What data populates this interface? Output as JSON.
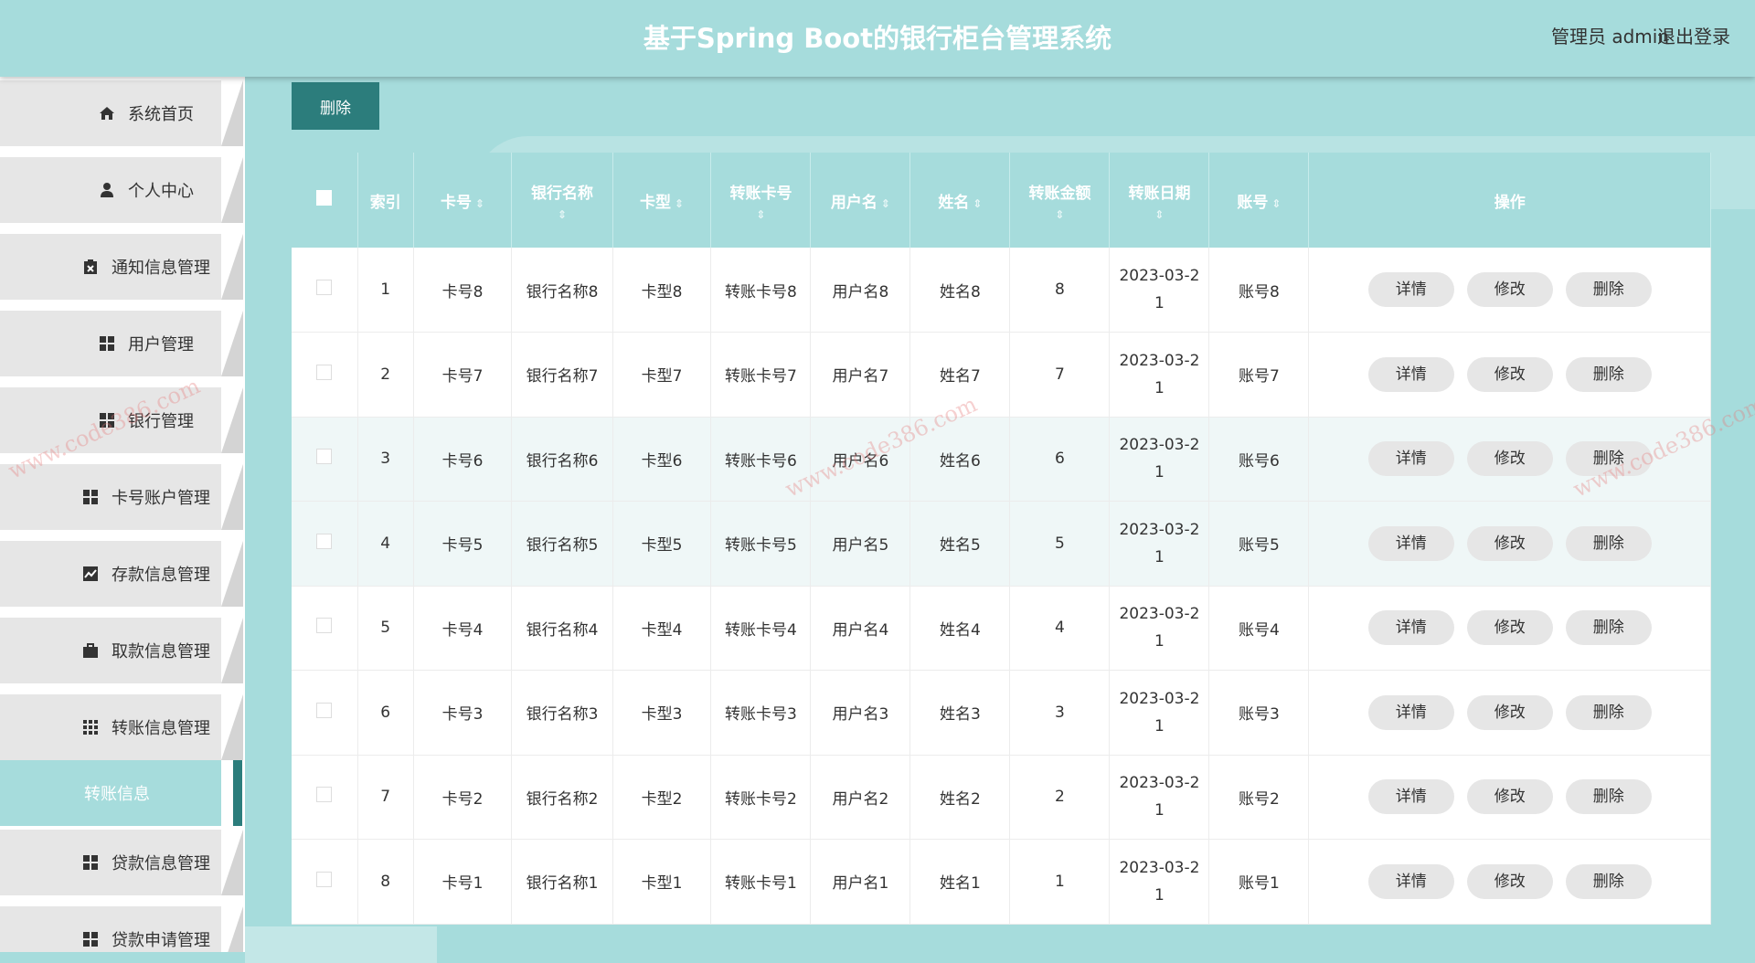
{
  "header": {
    "title": "基于Spring Boot的银行柜台管理系统",
    "user": "管理员 admin",
    "logout": "退出登录"
  },
  "sidebar": {
    "items": [
      {
        "label": "系统首页",
        "icon": "home-icon"
      },
      {
        "label": "个人中心",
        "icon": "user-icon"
      },
      {
        "label": "通知信息管理",
        "icon": "clipboard-icon"
      },
      {
        "label": "用户管理",
        "icon": "grid-icon"
      },
      {
        "label": "银行管理",
        "icon": "grid-icon"
      },
      {
        "label": "卡号账户管理",
        "icon": "grid-icon"
      },
      {
        "label": "存款信息管理",
        "icon": "chart-icon"
      },
      {
        "label": "取款信息管理",
        "icon": "briefcase-icon"
      },
      {
        "label": "转账信息管理",
        "icon": "table-icon"
      },
      {
        "label": "转账信息",
        "icon": "",
        "active": true
      },
      {
        "label": "贷款信息管理",
        "icon": "grid-icon"
      },
      {
        "label": "贷款申请管理",
        "icon": "grid-icon"
      }
    ]
  },
  "toolbar": {
    "delete_label": "删除"
  },
  "table": {
    "columns": [
      "索引",
      "卡号",
      "银行名称",
      "卡型",
      "转账卡号",
      "用户名",
      "姓名",
      "转账金额",
      "转账日期",
      "账号",
      "操作"
    ],
    "rows": [
      {
        "index": "1",
        "card": "卡号8",
        "bank": "银行名称8",
        "type": "卡型8",
        "tcard": "转账卡号8",
        "uname": "用户名8",
        "name": "姓名8",
        "amount": "8",
        "date1": "2023-03-2",
        "date2": "1",
        "account": "账号8"
      },
      {
        "index": "2",
        "card": "卡号7",
        "bank": "银行名称7",
        "type": "卡型7",
        "tcard": "转账卡号7",
        "uname": "用户名7",
        "name": "姓名7",
        "amount": "7",
        "date1": "2023-03-2",
        "date2": "1",
        "account": "账号7"
      },
      {
        "index": "3",
        "card": "卡号6",
        "bank": "银行名称6",
        "type": "卡型6",
        "tcard": "转账卡号6",
        "uname": "用户名6",
        "name": "姓名6",
        "amount": "6",
        "date1": "2023-03-2",
        "date2": "1",
        "account": "账号6"
      },
      {
        "index": "4",
        "card": "卡号5",
        "bank": "银行名称5",
        "type": "卡型5",
        "tcard": "转账卡号5",
        "uname": "用户名5",
        "name": "姓名5",
        "amount": "5",
        "date1": "2023-03-2",
        "date2": "1",
        "account": "账号5"
      },
      {
        "index": "5",
        "card": "卡号4",
        "bank": "银行名称4",
        "type": "卡型4",
        "tcard": "转账卡号4",
        "uname": "用户名4",
        "name": "姓名4",
        "amount": "4",
        "date1": "2023-03-2",
        "date2": "1",
        "account": "账号4"
      },
      {
        "index": "6",
        "card": "卡号3",
        "bank": "银行名称3",
        "type": "卡型3",
        "tcard": "转账卡号3",
        "uname": "用户名3",
        "name": "姓名3",
        "amount": "3",
        "date1": "2023-03-2",
        "date2": "1",
        "account": "账号3"
      },
      {
        "index": "7",
        "card": "卡号2",
        "bank": "银行名称2",
        "type": "卡型2",
        "tcard": "转账卡号2",
        "uname": "用户名2",
        "name": "姓名2",
        "amount": "2",
        "date1": "2023-03-2",
        "date2": "1",
        "account": "账号2"
      },
      {
        "index": "8",
        "card": "卡号1",
        "bank": "银行名称1",
        "type": "卡型1",
        "tcard": "转账卡号1",
        "uname": "用户名1",
        "name": "姓名1",
        "amount": "1",
        "date1": "2023-03-2",
        "date2": "1",
        "account": "账号1"
      }
    ],
    "actions": {
      "detail": "详情",
      "edit": "修改",
      "delete": "删除"
    }
  },
  "watermark": "www.code386.com",
  "colors": {
    "primary": "#a6dcdc",
    "accent": "#2c7d7c",
    "button": "#e6e6e6"
  }
}
